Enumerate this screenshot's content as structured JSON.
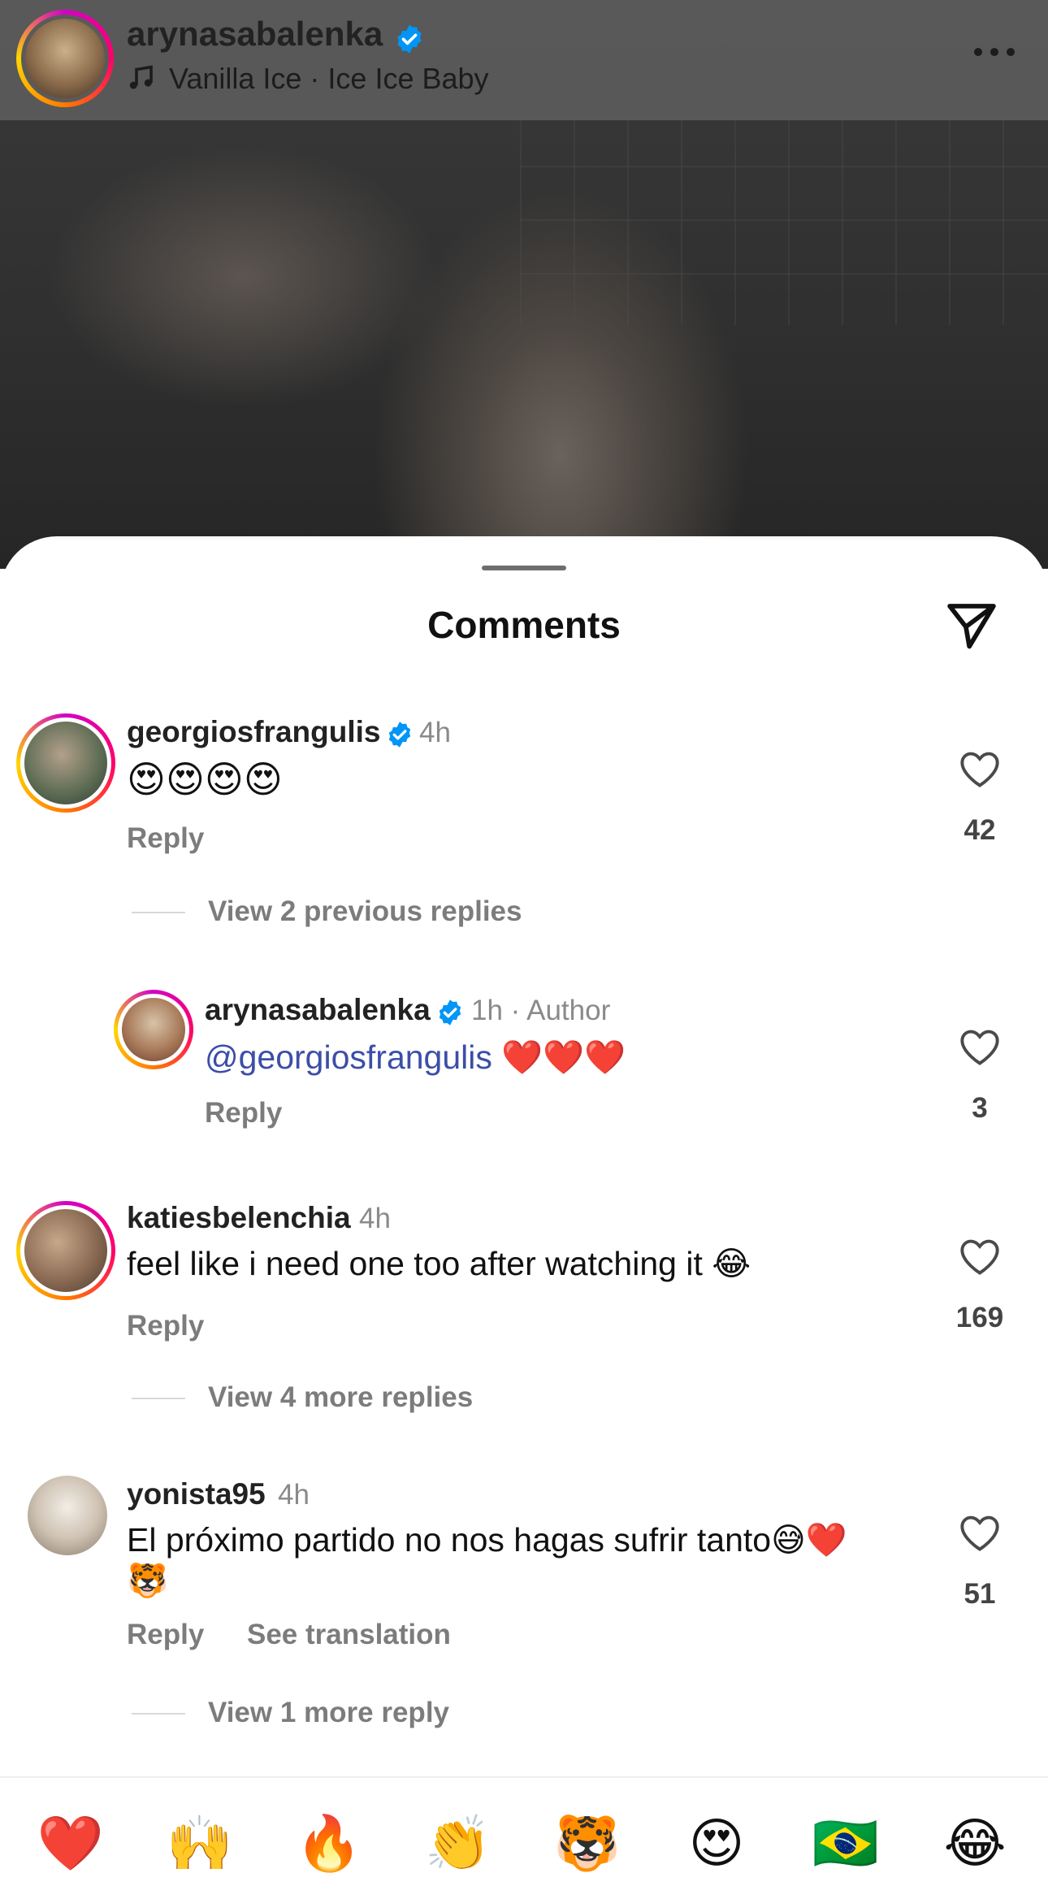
{
  "header": {
    "username": "arynasabalenka",
    "music": "Vanilla Ice · Ice Ice Baby"
  },
  "sheet": {
    "title": "Comments"
  },
  "comments": [
    {
      "username": "georgiosfrangulis",
      "time": "4h",
      "text": "😍😍😍😍",
      "reply": "Reply",
      "likes": "42",
      "view_replies": "View 2 previous replies"
    },
    {
      "username": "arynasabalenka",
      "time": "1h · Author",
      "mention": "@georgiosfrangulis",
      "text": "❤️❤️❤️",
      "reply": "Reply",
      "likes": "3"
    },
    {
      "username": "katiesbelenchia",
      "time": "4h",
      "text": "feel like i need one too after watching it 😂",
      "reply": "Reply",
      "likes": "169",
      "view_replies": "View 4 more replies"
    },
    {
      "username": "yonista95",
      "time": "4h",
      "text_line1": "El próximo partido no nos hagas sufrir tanto😅❤️",
      "text_line2": "🐯",
      "reply": "Reply",
      "see_translation": "See translation",
      "likes": "51",
      "view_replies": "View 1 more reply"
    }
  ],
  "reactions": [
    "❤️",
    "🙌",
    "🔥",
    "👏",
    "🐯",
    "😍",
    "🇧🇷",
    "😂"
  ],
  "colors": {
    "verified": "#0095f6",
    "mention": "#3c4ea8",
    "story_ring": [
      "#d300c5",
      "#ff0069",
      "#ff7a00",
      "#ffd600"
    ]
  },
  "icons": {
    "header_verified": "verified-badge-icon",
    "music": "music-note-icon",
    "more": "more-options-icon",
    "send": "send-paper-plane-icon",
    "like": "heart-outline-icon"
  }
}
